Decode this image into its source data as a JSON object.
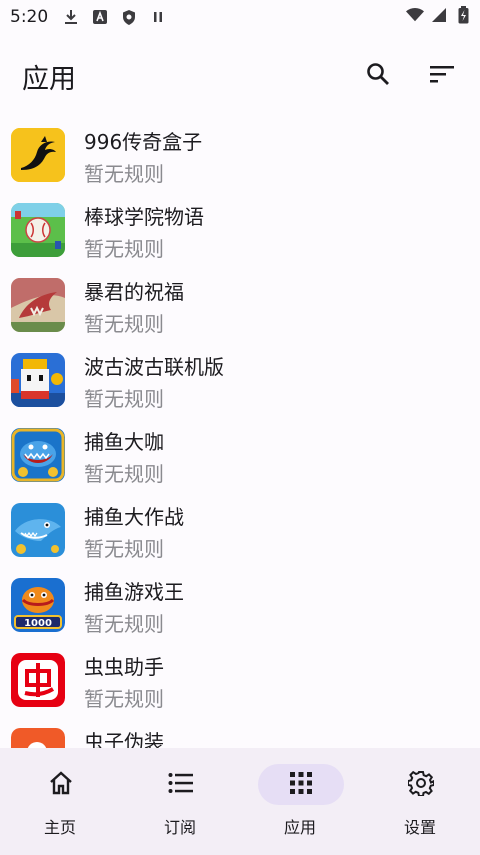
{
  "status": {
    "time": "5:20"
  },
  "app_bar": {
    "title": "应用"
  },
  "apps": [
    {
      "name": "996传奇盒子",
      "rule": "暂无规则"
    },
    {
      "name": "棒球学院物语",
      "rule": "暂无规则"
    },
    {
      "name": "暴君的祝福",
      "rule": "暂无规则"
    },
    {
      "name": "波古波古联机版",
      "rule": "暂无规则"
    },
    {
      "name": "捕鱼大咖",
      "rule": "暂无规则"
    },
    {
      "name": "捕鱼大作战",
      "rule": "暂无规则"
    },
    {
      "name": "捕鱼游戏王",
      "rule": "暂无规则"
    },
    {
      "name": "虫虫助手",
      "rule": "暂无规则"
    },
    {
      "name": "虫子伪装",
      "rule": ""
    }
  ],
  "app_icon_labels": {
    "fishing_king_badge": "1000"
  },
  "nav": [
    {
      "label": "主页",
      "icon": "home-icon",
      "active": false
    },
    {
      "label": "订阅",
      "icon": "list-icon",
      "active": false
    },
    {
      "label": "应用",
      "icon": "apps-grid-icon",
      "active": true
    },
    {
      "label": "设置",
      "icon": "gear-icon",
      "active": false
    }
  ],
  "colors": {
    "background": "#fdfbfe",
    "nav_background": "#f3eef6",
    "nav_active": "#e6def5",
    "secondary_text": "#8a8a8f"
  }
}
